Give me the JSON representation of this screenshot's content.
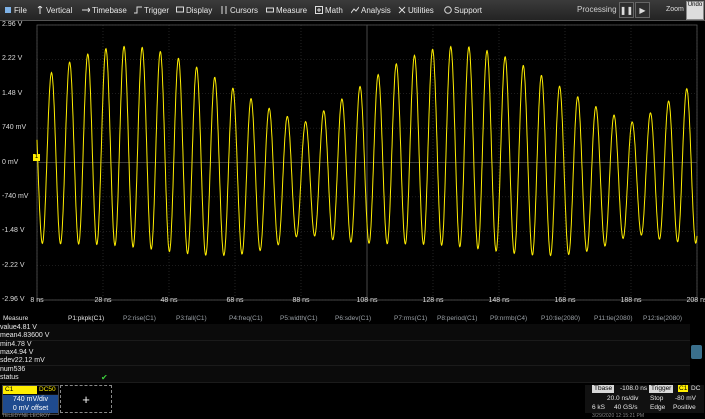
{
  "menu": [
    {
      "label": "File",
      "icon": "file-icon"
    },
    {
      "label": "Vertical",
      "icon": "vertical-icon"
    },
    {
      "label": "Timebase",
      "icon": "timebase-icon"
    },
    {
      "label": "Trigger",
      "icon": "trigger-icon"
    },
    {
      "label": "Display",
      "icon": "display-icon"
    },
    {
      "label": "Cursors",
      "icon": "cursors-icon"
    },
    {
      "label": "Measure",
      "icon": "measure-icon"
    },
    {
      "label": "Math",
      "icon": "math-icon"
    },
    {
      "label": "Analysis",
      "icon": "analysis-icon"
    },
    {
      "label": "Utilities",
      "icon": "utilities-icon"
    },
    {
      "label": "Support",
      "icon": "support-icon"
    }
  ],
  "toolbar": {
    "processing": "Processing",
    "pause_glyph": "❚❚",
    "play_glyph": "▶",
    "zoom": "Zoom",
    "undo": "Undo"
  },
  "colors": {
    "trace": "#ffee00",
    "grid": "#3a3a3a",
    "accent": "#1f4b8f"
  },
  "scope": {
    "y_labels": [
      "2.96 V",
      "2.22 V",
      "1.48 V",
      "740 mV",
      "0 mV",
      "-740 mV",
      "-1.48 V",
      "-2.22 V",
      "-2.96 V"
    ],
    "x_labels": [
      "8 ns",
      "28 ns",
      "48 ns",
      "68 ns",
      "88 ns",
      "108 ns",
      "128 ns",
      "148 ns",
      "168 ns",
      "188 ns",
      "208 ns"
    ],
    "channel_marker": "1"
  },
  "chart_data": {
    "type": "line",
    "xlabel": "",
    "ylabel": "",
    "xlim": [
      8,
      208
    ],
    "ylim": [
      -2.96,
      2.96
    ],
    "series": [
      {
        "amplitude_v": 2.4,
        "fast_period_ns": 5.5,
        "slow_period_ns": 100,
        "color": "#ffee00"
      }
    ]
  },
  "measure": {
    "title": "Measure",
    "columns": [
      "P1:pkpk(C1)",
      "P2:rise(C1)",
      "P3:fall(C1)",
      "P4:freq(C1)",
      "P5:width(C1)",
      "P6:sdev(C1)",
      "P7:rms(C1)",
      "P8:period(C1)",
      "P9:nrmb(C4)",
      "P10:tie(2080)",
      "P11:tie(2080)",
      "P12:tie(2080)"
    ],
    "rows": [
      {
        "label": "value",
        "value": "4.81 V"
      },
      {
        "label": "mean",
        "value": "4.83600 V"
      },
      {
        "label": "min",
        "value": "4.78 V"
      },
      {
        "label": "max",
        "value": "4.94 V"
      },
      {
        "label": "sdev",
        "value": "22.12 mV"
      },
      {
        "label": "num",
        "value": "536"
      },
      {
        "label": "status",
        "value": ""
      }
    ],
    "status_icon": "✔"
  },
  "channel": {
    "name": "C1",
    "tag": "DC50",
    "vdiv": "740 mV/div",
    "offset": "0 mV offset"
  },
  "add_button": "+",
  "brand": "TELEDYNE LECROY",
  "date": "3/29/2020 12:15:21 PM",
  "timebase": {
    "title": "Tbase",
    "pos": "-108.0 ns",
    "tdiv": "20.0 ns/div",
    "samples": "6 kS",
    "rate": "40 GS/s"
  },
  "trigger": {
    "title": "Trigger",
    "channel": "C1",
    "coupling": "DC",
    "mode": "Stop",
    "level": "-80 mV",
    "type": "Edge",
    "slope": "Positive"
  }
}
